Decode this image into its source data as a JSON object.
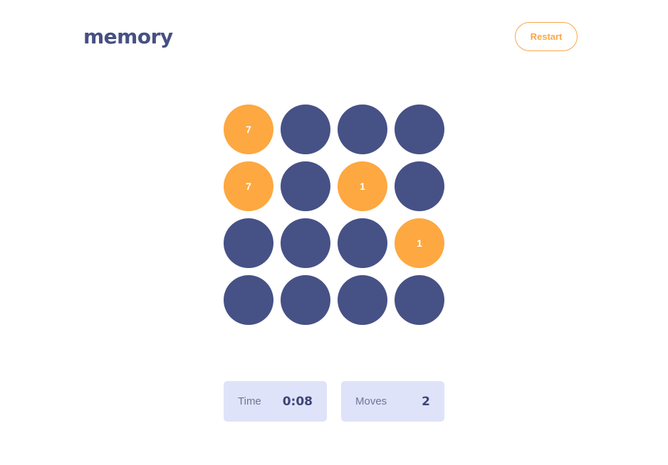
{
  "header": {
    "logo": "memory",
    "restart_label": "Restart"
  },
  "board": {
    "tiles": [
      {
        "state": "revealed",
        "value": "7"
      },
      {
        "state": "hidden",
        "value": ""
      },
      {
        "state": "hidden",
        "value": ""
      },
      {
        "state": "hidden",
        "value": ""
      },
      {
        "state": "revealed",
        "value": "7"
      },
      {
        "state": "hidden",
        "value": ""
      },
      {
        "state": "revealed",
        "value": "1"
      },
      {
        "state": "hidden",
        "value": ""
      },
      {
        "state": "hidden",
        "value": ""
      },
      {
        "state": "hidden",
        "value": ""
      },
      {
        "state": "hidden",
        "value": ""
      },
      {
        "state": "revealed",
        "value": "1"
      },
      {
        "state": "hidden",
        "value": ""
      },
      {
        "state": "hidden",
        "value": ""
      },
      {
        "state": "hidden",
        "value": ""
      },
      {
        "state": "hidden",
        "value": ""
      }
    ]
  },
  "stats": {
    "time_label": "Time",
    "time_value": "0:08",
    "moves_label": "Moves",
    "moves_value": "2"
  },
  "colors": {
    "hidden_tile": "#465186",
    "revealed_tile": "#fda841",
    "accent": "#f9a848",
    "logo": "#465083",
    "stat_bg": "#dfe3f9"
  }
}
